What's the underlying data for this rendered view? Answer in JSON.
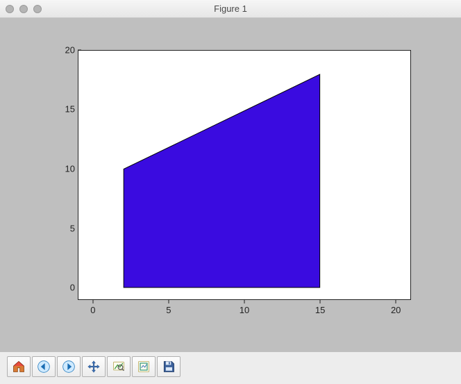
{
  "window": {
    "title": "Figure 1"
  },
  "chart_data": {
    "type": "area",
    "title": "",
    "xlabel": "",
    "ylabel": "",
    "xlim": [
      -1,
      21
    ],
    "ylim": [
      -1,
      20
    ],
    "xticks": [
      0,
      5,
      10,
      15,
      20
    ],
    "yticks": [
      0,
      5,
      10,
      15,
      20
    ],
    "polygon": {
      "vertices": [
        {
          "x": 2,
          "y": 0
        },
        {
          "x": 2,
          "y": 10
        },
        {
          "x": 15,
          "y": 18
        },
        {
          "x": 15,
          "y": 0
        }
      ],
      "facecolor": "#3a0be0",
      "edgecolor": "#000000"
    }
  },
  "y_tick_labels": {
    "t0": "0",
    "t5": "5",
    "t10": "10",
    "t15": "15",
    "t20": "20"
  },
  "x_tick_labels": {
    "t0": "0",
    "t5": "5",
    "t10": "10",
    "t15": "15",
    "t20": "20"
  },
  "toolbar": {
    "home": "Home",
    "back": "Back",
    "forward": "Forward",
    "pan": "Pan",
    "zoom": "Zoom",
    "subplots": "Configure subplots",
    "save": "Save"
  }
}
